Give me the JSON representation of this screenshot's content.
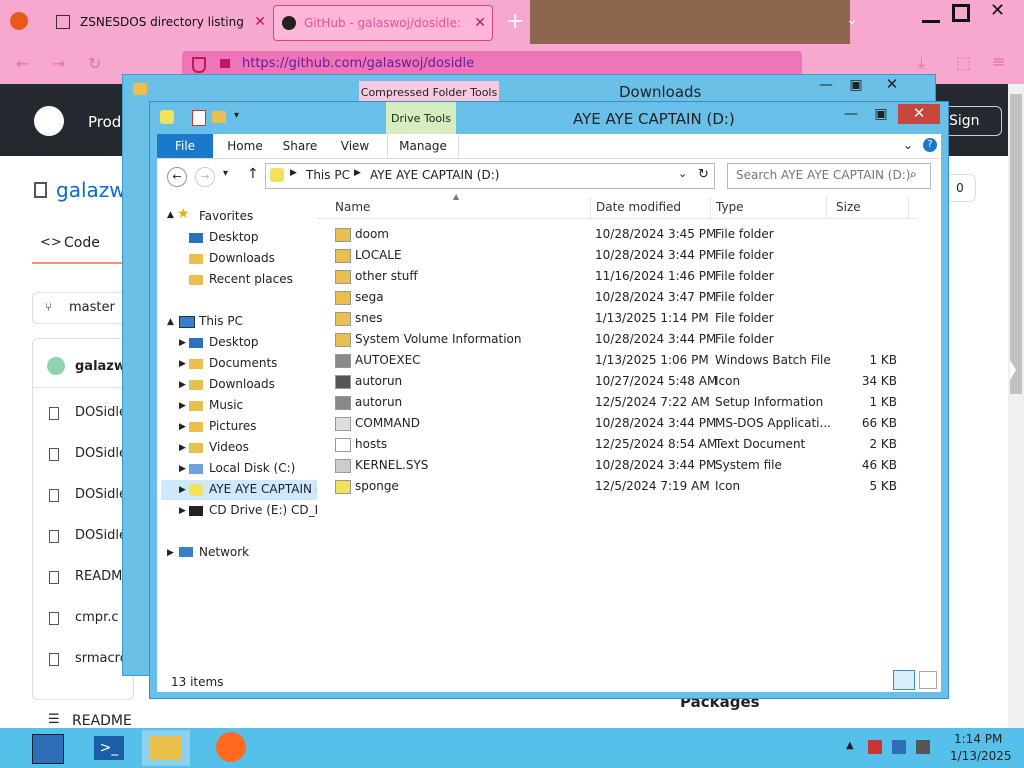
{
  "browser": {
    "tabs": [
      {
        "title": "ZSNESDOS directory listing"
      },
      {
        "title": "GitHub - galaswoj/dosidle: a p"
      }
    ],
    "new_tab": "+",
    "url": "https://github.com/galaswoj/dosidle"
  },
  "github": {
    "nav_label": "Prod",
    "signup": "Sign up",
    "repo_owner": "galazwo",
    "tab_code": "Code",
    "branch": "master",
    "commit_user": "galazwo",
    "files": [
      "DOSidle",
      "DOSidle",
      "DOSidle",
      "DOSidle",
      "READM",
      "cmpr.c",
      "srmacro"
    ],
    "readme": "README",
    "packages": "Packages",
    "badge": "0"
  },
  "downloads_window": {
    "title": "Downloads",
    "ribbon_context": "Compressed Folder Tools"
  },
  "explorer": {
    "title": "AYE AYE CAPTAIN (D:)",
    "ribbon_context": "Drive Tools",
    "ribbon_tabs": [
      "File",
      "Home",
      "Share",
      "View",
      "Manage"
    ],
    "address": {
      "root": "This PC",
      "current": "AYE AYE CAPTAIN (D:)"
    },
    "search_placeholder": "Search AYE AYE CAPTAIN (D:)",
    "columns": {
      "name": "Name",
      "date": "Date modified",
      "type": "Type",
      "size": "Size"
    },
    "nav": {
      "favorites": "Favorites",
      "fav_items": [
        "Desktop",
        "Downloads",
        "Recent places"
      ],
      "this_pc": "This PC",
      "pc_items": [
        "Desktop",
        "Documents",
        "Downloads",
        "Music",
        "Pictures",
        "Videos",
        "Local Disk (C:)",
        "AYE AYE CAPTAIN (D:)",
        "CD Drive (E:) CD_ROM"
      ],
      "network": "Network"
    },
    "files": [
      {
        "name": "doom",
        "date": "10/28/2024 3:45 PM",
        "type": "File folder",
        "size": "",
        "icon": "folder-icon"
      },
      {
        "name": "LOCALE",
        "date": "10/28/2024 3:44 PM",
        "type": "File folder",
        "size": "",
        "icon": "folder-icon"
      },
      {
        "name": "other stuff",
        "date": "11/16/2024 1:46 PM",
        "type": "File folder",
        "size": "",
        "icon": "folder-icon"
      },
      {
        "name": "sega",
        "date": "10/28/2024 3:47 PM",
        "type": "File folder",
        "size": "",
        "icon": "folder-icon"
      },
      {
        "name": "snes",
        "date": "1/13/2025 1:14 PM",
        "type": "File folder",
        "size": "",
        "icon": "folder-icon"
      },
      {
        "name": "System Volume Information",
        "date": "10/28/2024 3:44 PM",
        "type": "File folder",
        "size": "",
        "icon": "folder-icon"
      },
      {
        "name": "AUTOEXEC",
        "date": "1/13/2025 1:06 PM",
        "type": "Windows Batch File",
        "size": "1 KB",
        "icon": "batch-icon"
      },
      {
        "name": "autorun",
        "date": "10/27/2024 5:48 AM",
        "type": "Icon",
        "size": "34 KB",
        "icon": "ico-file-icon"
      },
      {
        "name": "autorun",
        "date": "12/5/2024 7:22 AM",
        "type": "Setup Information",
        "size": "1 KB",
        "icon": "setup-icon"
      },
      {
        "name": "COMMAND",
        "date": "10/28/2024 3:44 PM",
        "type": "MS-DOS Applicati...",
        "size": "66 KB",
        "icon": "dos-app-icon"
      },
      {
        "name": "hosts",
        "date": "12/25/2024 8:54 AM",
        "type": "Text Document",
        "size": "2 KB",
        "icon": "text-file-icon"
      },
      {
        "name": "KERNEL.SYS",
        "date": "10/28/2024 3:44 PM",
        "type": "System file",
        "size": "46 KB",
        "icon": "sys-file-icon"
      },
      {
        "name": "sponge",
        "date": "12/5/2024 7:19 AM",
        "type": "Icon",
        "size": "5 KB",
        "icon": "sponge-icon"
      }
    ],
    "status": "13 items"
  },
  "taskbar": {
    "time": "1:14 PM",
    "date": "1/13/2025"
  }
}
